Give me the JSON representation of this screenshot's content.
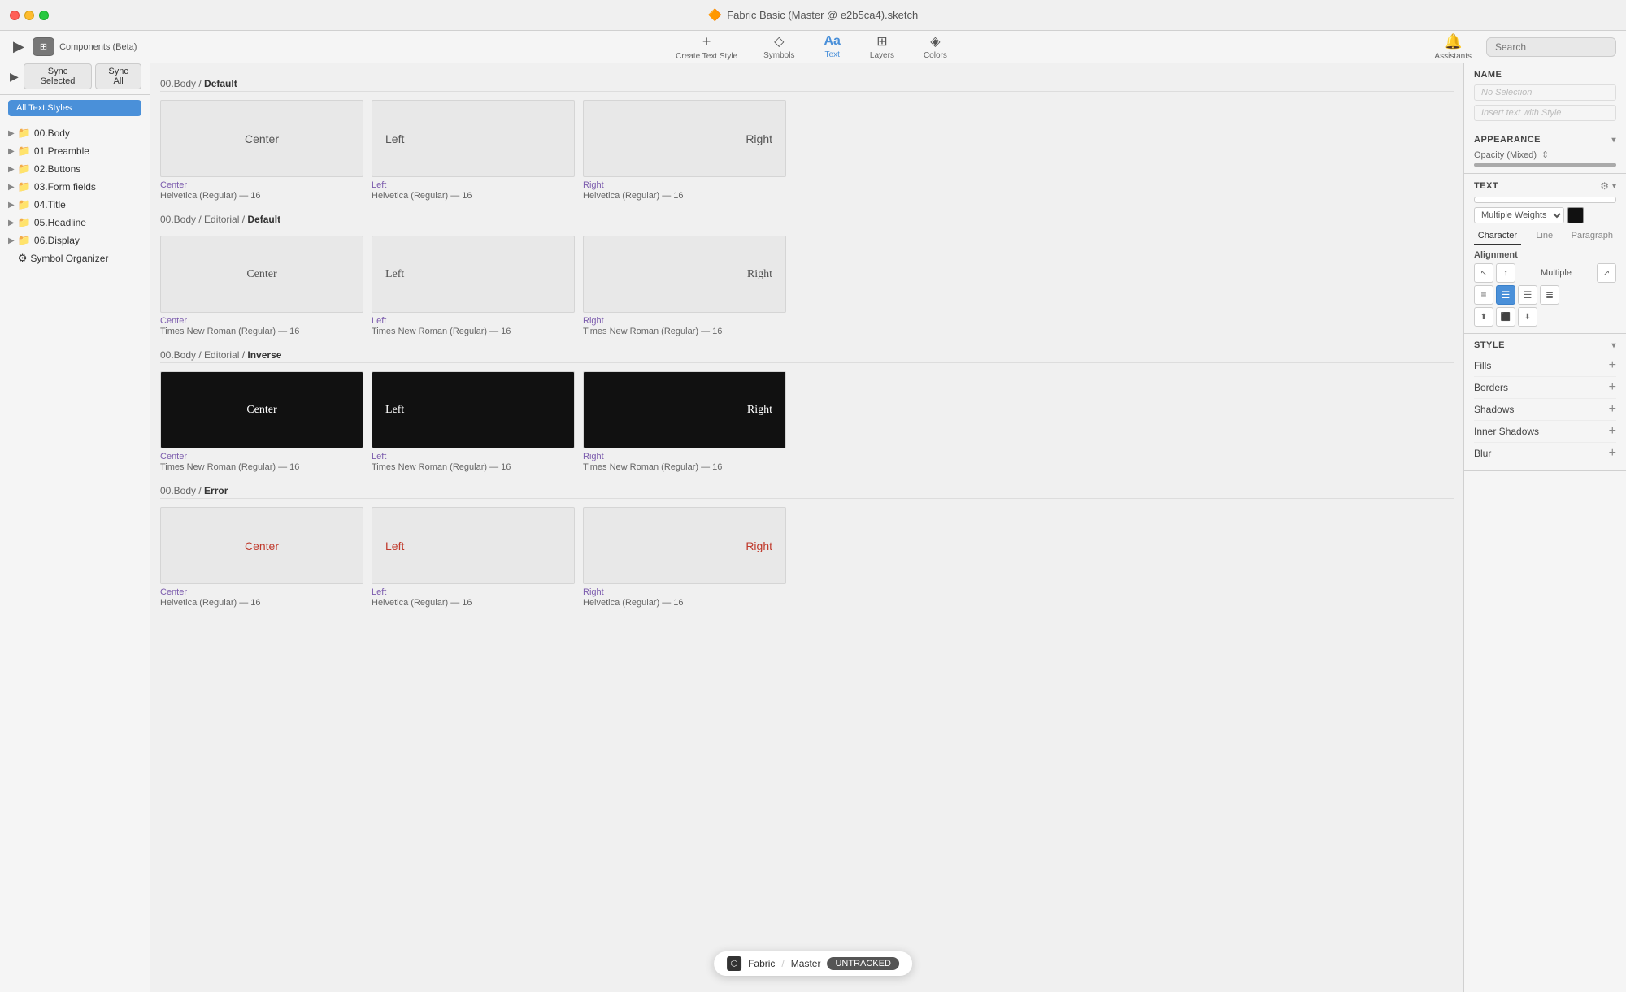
{
  "window": {
    "title": "Fabric Basic (Master @ e2b5ca4).sketch",
    "title_icon": "🔶"
  },
  "toolbar": {
    "create_text_style_label": "Create Text Style",
    "symbols_label": "Symbols",
    "text_label": "Text",
    "layers_label": "Layers",
    "colors_label": "Colors",
    "assistants_label": "Assistants",
    "search_placeholder": "Search"
  },
  "sidebar": {
    "components_label": "Components (Beta)",
    "sync_selected_label": "Sync Selected",
    "sync_all_label": "Sync All",
    "all_text_styles_label": "All Text Styles",
    "items": [
      {
        "label": "00.Body",
        "icon": "folder"
      },
      {
        "label": "01.Preamble",
        "icon": "folder"
      },
      {
        "label": "02.Buttons",
        "icon": "folder"
      },
      {
        "label": "03.Form fields",
        "icon": "folder"
      },
      {
        "label": "04.Title",
        "icon": "folder"
      },
      {
        "label": "05.Headline",
        "icon": "folder"
      },
      {
        "label": "06.Display",
        "icon": "folder"
      },
      {
        "label": "Symbol Organizer",
        "icon": "plugin"
      }
    ]
  },
  "main": {
    "sections": [
      {
        "id": "body-default",
        "breadcrumb": "00.Body",
        "separator": "/",
        "name": "Default",
        "cards": [
          {
            "text": "Center",
            "name_color": "purple",
            "name": "Center",
            "meta": "Helvetica (Regular) — 16",
            "dark": false,
            "align": "center"
          },
          {
            "text": "Left",
            "name_color": "purple",
            "name": "Left",
            "meta": "Helvetica (Regular) — 16",
            "dark": false,
            "align": "flex-start"
          },
          {
            "text": "Right",
            "name_color": "purple",
            "name": "Right",
            "meta": "Helvetica (Regular) — 16",
            "dark": false,
            "align": "flex-end"
          }
        ]
      },
      {
        "id": "body-editorial-default",
        "breadcrumb": "00.Body / Editorial",
        "separator": "/",
        "name": "Default",
        "cards": [
          {
            "text": "Center",
            "name_color": "purple",
            "name": "Center",
            "meta": "Times New Roman (Regular) — 16",
            "dark": false,
            "align": "center"
          },
          {
            "text": "Left",
            "name_color": "purple",
            "name": "Left",
            "meta": "Times New Roman (Regular) — 16",
            "dark": false,
            "align": "flex-start"
          },
          {
            "text": "Right",
            "name_color": "purple",
            "name": "Right",
            "meta": "Times New Roman (Regular) — 16",
            "dark": false,
            "align": "flex-end"
          }
        ]
      },
      {
        "id": "body-editorial-inverse",
        "breadcrumb": "00.Body / Editorial",
        "separator": "/",
        "name": "Inverse",
        "cards": [
          {
            "text": "Center",
            "name_color": "purple",
            "name": "Center",
            "meta": "Times New Roman (Regular) — 16",
            "dark": true,
            "align": "center"
          },
          {
            "text": "Left",
            "name_color": "purple",
            "name": "Left",
            "meta": "Times New Roman (Regular) — 16",
            "dark": true,
            "align": "flex-start"
          },
          {
            "text": "Right",
            "name_color": "purple",
            "name": "Right",
            "meta": "Times New Roman (Regular) — 16",
            "dark": true,
            "align": "flex-end"
          }
        ]
      },
      {
        "id": "body-error",
        "breadcrumb": "00.Body",
        "separator": "/",
        "name": "Error",
        "cards": [
          {
            "text": "Center",
            "name_color": "purple",
            "name": "Center",
            "meta": "Helvetica (Regular) — 16",
            "dark": false,
            "align": "center",
            "error": true
          },
          {
            "text": "Left",
            "name_color": "purple",
            "name": "Left",
            "meta": "Helvetica (Regular) — 16",
            "dark": false,
            "align": "flex-start",
            "error": true
          },
          {
            "text": "Right",
            "name_color": "purple",
            "name": "Right",
            "meta": "Helvetica (Regular) — 16",
            "dark": false,
            "align": "flex-end",
            "error": true
          }
        ]
      }
    ]
  },
  "right_panel": {
    "name_section": {
      "label": "NAME",
      "no_selection": "No Selection"
    },
    "insert_text": "Insert text with Style",
    "appearance_section": {
      "label": "APPEARANCE",
      "opacity_label": "Opacity (Mixed)"
    },
    "text_section": {
      "label": "TEXT",
      "multiple_weights": "Multiple Weights",
      "tabs": [
        "Character",
        "Line",
        "Paragraph"
      ],
      "active_tab": "Character",
      "alignment_label": "Alignment",
      "alignment_multiple": "Multiple"
    },
    "style_section": {
      "label": "STYLE",
      "items": [
        {
          "label": "Fills",
          "has_add": true
        },
        {
          "label": "Borders",
          "has_add": true
        },
        {
          "label": "Shadows",
          "has_add": true
        },
        {
          "label": "Inner Shadows",
          "has_add": true
        },
        {
          "label": "Blur",
          "has_add": true
        }
      ]
    }
  },
  "status_bar": {
    "icon": "⬡",
    "fabric_label": "Fabric",
    "sep": "/",
    "master_label": "Master",
    "untracked_label": "UNTRACKED"
  }
}
